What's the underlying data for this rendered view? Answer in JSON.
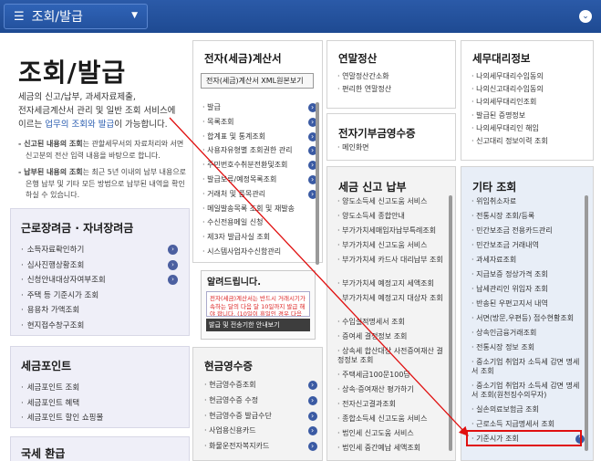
{
  "topbar": {
    "menu_label": "조회/발급"
  },
  "intro": {
    "title": "조회/발급",
    "line1": "세금의 신고/납부, 과세자료제출,",
    "line2": "전자세금계산서 관리 및 일반 조회 서비스에",
    "line3_prefix": "이르는 ",
    "line3_link": "업무의 조회와 발급",
    "line3_suffix": "이 가능합니다.",
    "note1_bold": "- 신고된 내용의 조회",
    "note1_rest": "는 관할세무서의 자료처리와 서면신고분의 전산 입력 내용을 바탕으로 합니다.",
    "note2_bold": "- 납부된 내용의 조회",
    "note2_rest": "는 최근 5년 이내의 납부 내용으로 은행 납부 및 기타 모든 방법으로 납부된 내역을 확인하실 수 있습니다."
  },
  "panels": {
    "work_cert": {
      "title": "근로장려금 · 자녀장려금",
      "items": [
        "소득자료확인하기",
        "심사진행상황조회",
        "신청안내대상자여부조회",
        "주택 등 기준시가 조회",
        "용용차 가액조회",
        "현지접수창구조회"
      ]
    },
    "tax_point": {
      "title": "세금포인트",
      "items": [
        "세금포인트 조회",
        "세금포인트 혜택",
        "세금포인트 할인 쇼핑몰"
      ]
    },
    "refund": {
      "title": "국세 환급"
    }
  },
  "e_invoice": {
    "title": "전자(세금)계산서",
    "tab_label": "전자(세금)계산서 XML원본보기",
    "items": [
      "발급",
      "목록조회",
      "합계표 및 통계조회",
      "사용자유형별 조회권한 관리",
      "주민번호수취분전환및조회",
      "발급보류/예정목록조회",
      "거래처 및 품목관리",
      "메일발송목록 조회 및 재발송",
      "수신전용메일 신청",
      "제3자 발급사실 조회",
      "시스템사업자수신함관리"
    ]
  },
  "alert": {
    "title": "알려드립니다.",
    "text": "전자(세금)계산서는 반드시 거래시기가 속하는 달의 다음 달 10일까지 발급 해야 합니다. (10일이 휴일인 경우 다음날로 연장됩니다)",
    "button": "발급 및 전송기한 안내보기"
  },
  "cash_receipt": {
    "title": "현금영수증",
    "items": [
      "현금영수증조회",
      "현금영수증 수정",
      "현금영수증 발급수단",
      "사업용신용카드",
      "화물운전자복지카드"
    ]
  },
  "year_end": {
    "title": "연말정산",
    "items": [
      "연말정산간소화",
      "편리한 연말정산"
    ]
  },
  "e_donation": {
    "title": "전자기부금영수증",
    "items": [
      "메인화면"
    ]
  },
  "tax_report": {
    "title": "세금 신고 납부",
    "items": [
      "양도소득세 신고도움 서비스",
      "양도소득세 종합안내",
      "부가가치세매입자납부특례조회",
      "부가가치세 신고도움 서비스",
      "부가가치세 카드사 대리납부 조회",
      "부가가치세 예정고지 세액조회",
      "부가가치세 예정고지 대상자 조회",
      "수입실적명세서 조회",
      "증여세 결정정보 조회",
      "상속세 합산대상 사전증여재산 결정정보 조회",
      "주택세금100문100답",
      "상속·증여재산 평가하기",
      "전자신고결과조회",
      "종합소득세 신고도움 서비스",
      "법인세 신고도움 서비스",
      "법인세 중간예납 세액조회"
    ]
  },
  "tax_agent": {
    "title": "세무대리정보",
    "items": [
      "나의세무대리수임동의",
      "나의신고대리수임동의",
      "나의세무대리인조회",
      "발급된 증명정보",
      "나의세무대리인 해임",
      "신고대리 정보이력 조회"
    ]
  },
  "other": {
    "title": "기타 조회",
    "items": [
      "위임취소자료",
      "전통시장 조회/등록",
      "민간보조금 전용카드관리",
      "민간보조금 거래내역",
      "과세자료조회",
      "지급보증 정상가격 조회",
      "납세관리인 위임자 조회",
      "반송된 우편고지서 내역",
      "서면(방문,우편등) 접수현황조회",
      "상속인금융거래조회",
      "전통시장 정보 조회",
      "중소기업 취업자 소득세 감면 명세서 조회",
      "중소기업 취업자 소득세 감면 명세서 조회(원천징수의무자)",
      "실손의료보험금 조회",
      "근로소득 지급명세서 조회",
      "기준시가 조회"
    ]
  }
}
